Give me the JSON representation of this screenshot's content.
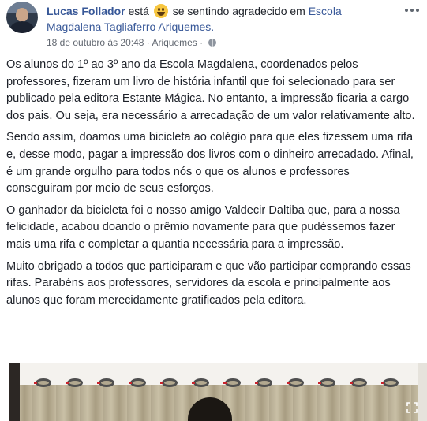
{
  "header": {
    "author": "Lucas Follador",
    "esta": "está",
    "feeling_text": "se sentindo agradecido em",
    "place_line1": "Escola",
    "place_line2": "Magdalena Tagliaferro Ariquemes.",
    "date": "18 de outubro às 20:48",
    "separator": "·",
    "location": "Ariquemes",
    "privacy_icon": "globe-icon",
    "feeling_icon": "grinning-emoji-icon",
    "menu_icon": "more-options-icon"
  },
  "post": {
    "paragraphs": [
      "Os alunos do 1º ao 3º ano da Escola Magdalena, coordenados pelos professores, fizeram um livro de história infantil que foi selecionado para ser publicado pela editora Estante Mágica. No entanto, a impressão ficaria a cargo dos pais. Ou seja, era necessário a arrecadação de um valor relativamente alto.",
      "Sendo assim, doamos uma bicicleta ao colégio para que eles fizessem uma rifa e, desse modo, pagar a impressão dos livros com o dinheiro arrecadado. Afinal, é um grande orgulho para todos nós o que os alunos e professores conseguiram por meio de seus esforços.",
      "O ganhador da bicicleta foi o nosso amigo Valdecir Daltiba que, para a nossa felicidade, acabou doando o prêmio novamente para que pudéssemos fazer mais uma rifa e completar a quantia necessária para a impressão.",
      "Muito obrigado a todos que participaram e que vão participar comprando essas rifas. Parabéns aos professores, servidores da escola e principalmente aos alunos que foram merecidamente gratificados pela editora."
    ]
  },
  "photo": {
    "expand_icon": "expand-icon"
  },
  "colors": {
    "link": "#385898",
    "text": "#1d2129",
    "meta": "#616770",
    "ring_accent": "#c8232c"
  }
}
